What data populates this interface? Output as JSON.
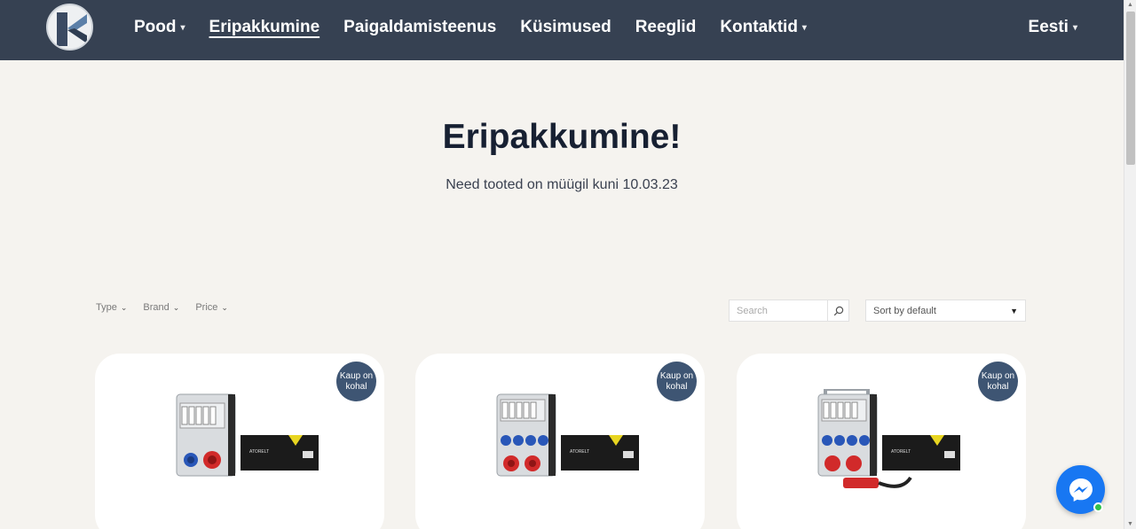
{
  "nav": {
    "items": [
      {
        "label": "Pood",
        "has_dropdown": true,
        "active": false
      },
      {
        "label": "Eripakkumine",
        "has_dropdown": false,
        "active": true
      },
      {
        "label": "Paigaldamisteenus",
        "has_dropdown": false,
        "active": false
      },
      {
        "label": "Küsimused",
        "has_dropdown": false,
        "active": false
      },
      {
        "label": "Reeglid",
        "has_dropdown": false,
        "active": false
      },
      {
        "label": "Kontaktid",
        "has_dropdown": true,
        "active": false
      }
    ],
    "language": "Eesti",
    "caret": "▾"
  },
  "hero": {
    "title": "Eripakkumine!",
    "subtitle": "Need tooted on müügil kuni 10.03.23"
  },
  "filters": {
    "items": [
      "Type",
      "Brand",
      "Price"
    ],
    "chevron": "⌄"
  },
  "search": {
    "placeholder": "Search"
  },
  "sort": {
    "selected": "Sort by default",
    "arrow": "▼"
  },
  "products": [
    {
      "badge": "Kaup on kohal",
      "variant": "two-sockets"
    },
    {
      "badge": "Kaup on kohal",
      "variant": "four-sockets"
    },
    {
      "badge": "Kaup on kohal",
      "variant": "four-sockets-plug"
    }
  ],
  "colors": {
    "nav_bg": "#364152",
    "page_bg": "#f5f3ef",
    "badge_bg": "#3e5573",
    "messenger": "#1877f2"
  }
}
